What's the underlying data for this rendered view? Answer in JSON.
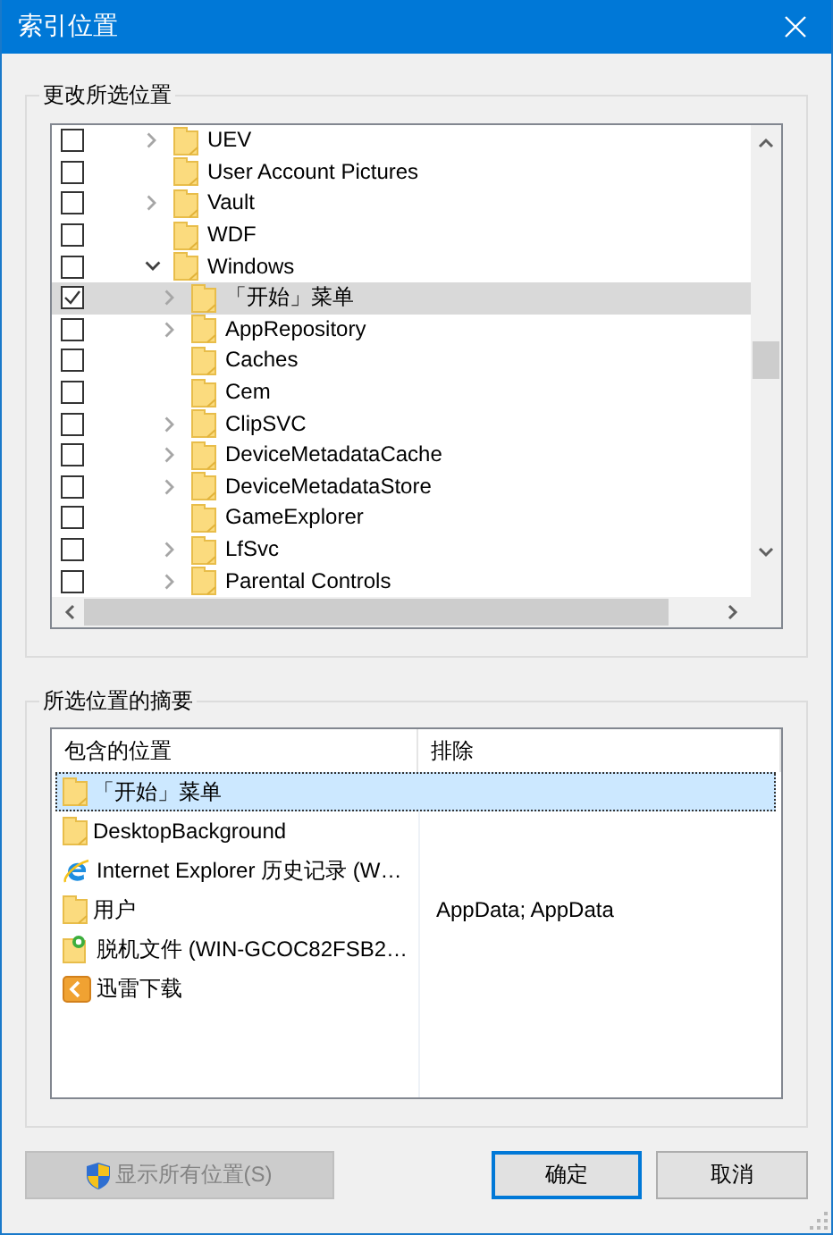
{
  "window": {
    "title": "索引位置"
  },
  "tree_group": {
    "label": "更改所选位置"
  },
  "tree": {
    "items": [
      {
        "name": "UEV",
        "checked": false,
        "selected": false,
        "expanded": false
      },
      {
        "name": "User Account Pictures",
        "checked": false,
        "selected": false
      },
      {
        "name": "Vault",
        "checked": false,
        "selected": false,
        "expanded": false
      },
      {
        "name": "WDF",
        "checked": false,
        "selected": false
      },
      {
        "name": "Windows",
        "checked": false,
        "selected": false,
        "expanded": true,
        "children": [
          {
            "name": "「开始」菜单",
            "checked": true,
            "selected": true,
            "expanded": false
          },
          {
            "name": "AppRepository",
            "checked": false,
            "selected": false,
            "expanded": false
          },
          {
            "name": "Caches",
            "checked": false,
            "selected": false
          },
          {
            "name": "Cem",
            "checked": false,
            "selected": false
          },
          {
            "name": "ClipSVC",
            "checked": false,
            "selected": false,
            "expanded": false
          },
          {
            "name": "DeviceMetadataCache",
            "checked": false,
            "selected": false,
            "expanded": false
          },
          {
            "name": "DeviceMetadataStore",
            "checked": false,
            "selected": false,
            "expanded": false
          },
          {
            "name": "GameExplorer",
            "checked": false,
            "selected": false
          },
          {
            "name": "LfSvc",
            "checked": false,
            "selected": false,
            "expanded": false
          },
          {
            "name": "Parental Controls",
            "checked": false,
            "selected": false,
            "expanded": false
          }
        ]
      }
    ]
  },
  "summary_group": {
    "label": "所选位置的摘要"
  },
  "summary": {
    "columns": [
      "包含的位置",
      "排除"
    ],
    "rows": [
      {
        "kind": "folder",
        "location": "「开始」菜单",
        "selected": true
      },
      {
        "kind": "folder",
        "location": "DesktopBackground",
        "selected": false
      },
      {
        "kind": "browser",
        "location": "Internet Explorer 历史记录 (W…",
        "selected": false
      },
      {
        "kind": "folder",
        "location": "用户",
        "exclude": "AppData; AppData",
        "selected": false
      },
      {
        "kind": "offline",
        "location": "脱机文件 (WIN-GCOC82FSB2…",
        "selected": false
      },
      {
        "kind": "download",
        "location": "迅雷下载",
        "selected": false
      }
    ]
  },
  "buttons": [
    {
      "label": "显示所有位置(S)",
      "kind": "shield",
      "disabled": true,
      "default": false
    },
    {
      "label": "确定",
      "kind": "plain",
      "disabled": false,
      "default": true
    },
    {
      "label": "取消",
      "kind": "plain",
      "disabled": false,
      "default": false
    }
  ]
}
